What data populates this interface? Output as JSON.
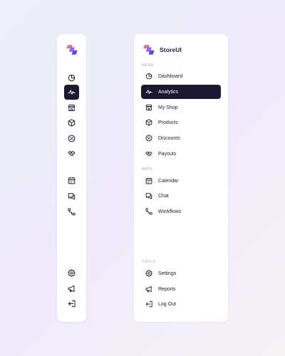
{
  "brand": {
    "name": "StoreUI",
    "logo_colors": [
      "#f06ba5",
      "#8b5cf6",
      "#4f46e5"
    ]
  },
  "colors": {
    "active_bg": "#1c1832",
    "icon": "#1b1833",
    "active_icon": "#ffffff",
    "section_label": "#a4a3b2"
  },
  "sections": {
    "menu": "MENU",
    "apps": "APPS",
    "tools": "TOOLS"
  },
  "menu_items": [
    {
      "label": "Dashboard",
      "icon": "pie-chart-icon",
      "active": false
    },
    {
      "label": "Analytics",
      "icon": "activity-icon",
      "active": true
    },
    {
      "label": "My Shop",
      "icon": "store-icon",
      "active": false
    },
    {
      "label": "Products",
      "icon": "box-icon",
      "active": false
    },
    {
      "label": "Discounts",
      "icon": "discount-icon",
      "active": false
    },
    {
      "label": "Payouts",
      "icon": "handshake-icon",
      "active": false
    }
  ],
  "app_items": [
    {
      "label": "Calendar",
      "icon": "calendar-icon",
      "active": false
    },
    {
      "label": "Chat",
      "icon": "chat-icon",
      "active": false
    },
    {
      "label": "Workflows",
      "icon": "workflow-icon",
      "active": false
    }
  ],
  "tool_items": [
    {
      "label": "Settings",
      "icon": "gear-icon",
      "active": false
    },
    {
      "label": "Reports",
      "icon": "megaphone-icon",
      "active": false
    },
    {
      "label": "Log Out",
      "icon": "logout-icon",
      "active": false
    }
  ]
}
